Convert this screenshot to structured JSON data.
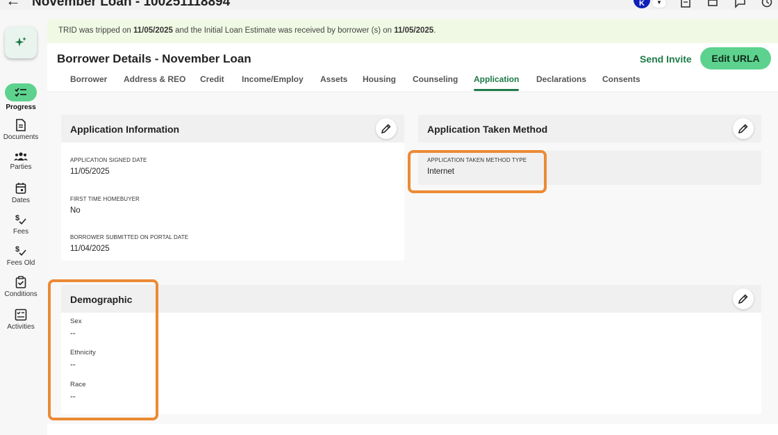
{
  "header": {
    "title": "November Loan - 1002511188​94",
    "avatar_initial": "K"
  },
  "banner": {
    "prefix": "TRID was tripped on ",
    "date1": "11/05/2025",
    "middle": " and the Initial Loan Estimate was received by borrower (s) on ",
    "date2": "11/05/2025",
    "suffix": "."
  },
  "sidebar": {
    "items": [
      {
        "label": "Progress",
        "icon": "progress-checklist-icon"
      },
      {
        "label": "Documents",
        "icon": "document-icon"
      },
      {
        "label": "Parties",
        "icon": "people-icon"
      },
      {
        "label": "Dates",
        "icon": "calendar-icon"
      },
      {
        "label": "Fees",
        "icon": "dollar-check-icon"
      },
      {
        "label": "Fees Old",
        "icon": "dollar-check-icon"
      },
      {
        "label": "Conditions",
        "icon": "clipboard-check-icon"
      },
      {
        "label": "Activities",
        "icon": "checklist-box-icon"
      }
    ]
  },
  "page": {
    "title": "Borrower Details - November Loan",
    "send_invite": "Send Invite",
    "edit_urla": "Edit URLA"
  },
  "tabs": [
    "Borrower",
    "Address & REO",
    "Credit",
    "Income/Employ",
    "Assets",
    "Housing",
    "Counseling",
    "Application",
    "Declarations",
    "Consents"
  ],
  "active_tab": "Application",
  "application_information": {
    "title": "Application Information",
    "fields": [
      {
        "label": "APPLICATION SIGNED DATE",
        "value": "11/05/2025"
      },
      {
        "label": "FIRST TIME HOMEBUYER",
        "value": "No"
      },
      {
        "label": "BORROWER SUBMITTED ON PORTAL DATE",
        "value": "11/04/2025"
      }
    ]
  },
  "application_taken_method": {
    "title": "Application Taken Method",
    "fields": [
      {
        "label": "APPLICATION TAKEN METHOD TYPE",
        "value": "Internet"
      }
    ]
  },
  "demographic": {
    "title": "Demographic",
    "fields": [
      {
        "label": "Sex",
        "value": "--"
      },
      {
        "label": "Ethnicity",
        "value": "--"
      },
      {
        "label": "Race",
        "value": "--"
      }
    ]
  },
  "colors": {
    "accent_green": "#5dd28e",
    "text_green": "#1d7a47",
    "highlight_orange": "#ec8a35",
    "banner_bg": "#f0f9e4",
    "avatar_blue": "#0d1fb8"
  }
}
